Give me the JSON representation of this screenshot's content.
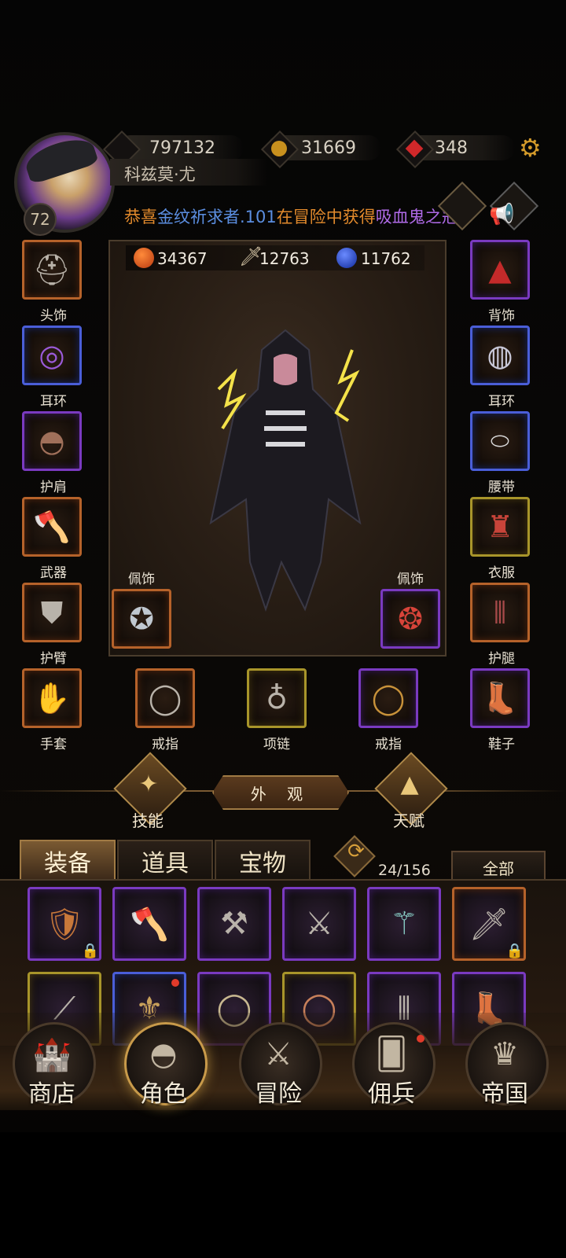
{
  "header": {
    "currencies": [
      {
        "icon": "energy-icon",
        "value": "797132"
      },
      {
        "icon": "gold-coin-icon",
        "value": "31669"
      },
      {
        "icon": "ruby-icon",
        "value": "348"
      }
    ],
    "player_name": "科兹莫·尤",
    "level": "72",
    "settings_icon": "gear-icon"
  },
  "ticker": {
    "prefix": "恭喜",
    "player": "金纹祈求者.101",
    "middle": "在冒险中获得",
    "item": "吸血鬼之冠",
    "suffix": ","
  },
  "stats": [
    {
      "icon": "health-orb-icon",
      "value": "34367"
    },
    {
      "icon": "sword-icon",
      "value": "12763"
    },
    {
      "icon": "mana-orb-icon",
      "value": "11762"
    }
  ],
  "equipment": {
    "left": [
      {
        "label": "头饰",
        "rarity": "orange",
        "icon": "helmet-icon"
      },
      {
        "label": "耳环",
        "rarity": "blue",
        "icon": "earring-icon"
      },
      {
        "label": "护肩",
        "rarity": "purple",
        "icon": "pauldron-icon"
      },
      {
        "label": "武器",
        "rarity": "orange",
        "icon": "axe-icon"
      },
      {
        "label": "护臂",
        "rarity": "orange",
        "icon": "bracer-icon"
      }
    ],
    "right": [
      {
        "label": "背饰",
        "rarity": "purple",
        "icon": "cape-icon"
      },
      {
        "label": "耳环",
        "rarity": "blue",
        "icon": "ring-icon"
      },
      {
        "label": "腰带",
        "rarity": "blue",
        "icon": "belt-icon"
      },
      {
        "label": "衣服",
        "rarity": "yellow",
        "icon": "armor-icon"
      },
      {
        "label": "护腿",
        "rarity": "orange",
        "icon": "greaves-icon"
      }
    ],
    "trinkets": [
      {
        "label": "佩饰",
        "rarity": "orange",
        "icon": "amulet-icon"
      },
      {
        "label": "佩饰",
        "rarity": "purple",
        "icon": "medallion-icon"
      }
    ],
    "bottom": [
      {
        "label": "手套",
        "rarity": "orange",
        "icon": "glove-icon"
      },
      {
        "label": "戒指",
        "rarity": "orange",
        "icon": "ring-icon"
      },
      {
        "label": "项链",
        "rarity": "yellow",
        "icon": "necklace-icon"
      },
      {
        "label": "戒指",
        "rarity": "purple",
        "icon": "ring-icon"
      },
      {
        "label": "鞋子",
        "rarity": "purple",
        "icon": "boot-icon"
      }
    ]
  },
  "middle_nav": {
    "skills": "技能",
    "appearance": "外 观",
    "talent": "天赋"
  },
  "inventory": {
    "tabs": [
      "装备",
      "道具",
      "宝物"
    ],
    "active_tab": "装备",
    "count": "24/156",
    "filter": "全部"
  },
  "bottom_nav": [
    "商店",
    "角色",
    "冒险",
    "佣兵",
    "帝国"
  ],
  "colors": {
    "orange_rarity": "#b5622a",
    "purple_rarity": "#7a3ac0",
    "blue_rarity": "#4a5ed8",
    "yellow_rarity": "#a8952a",
    "ticker_orange": "#e28a2c",
    "ticker_blue": "#5b8ee0",
    "ticker_purple": "#b06be8"
  }
}
